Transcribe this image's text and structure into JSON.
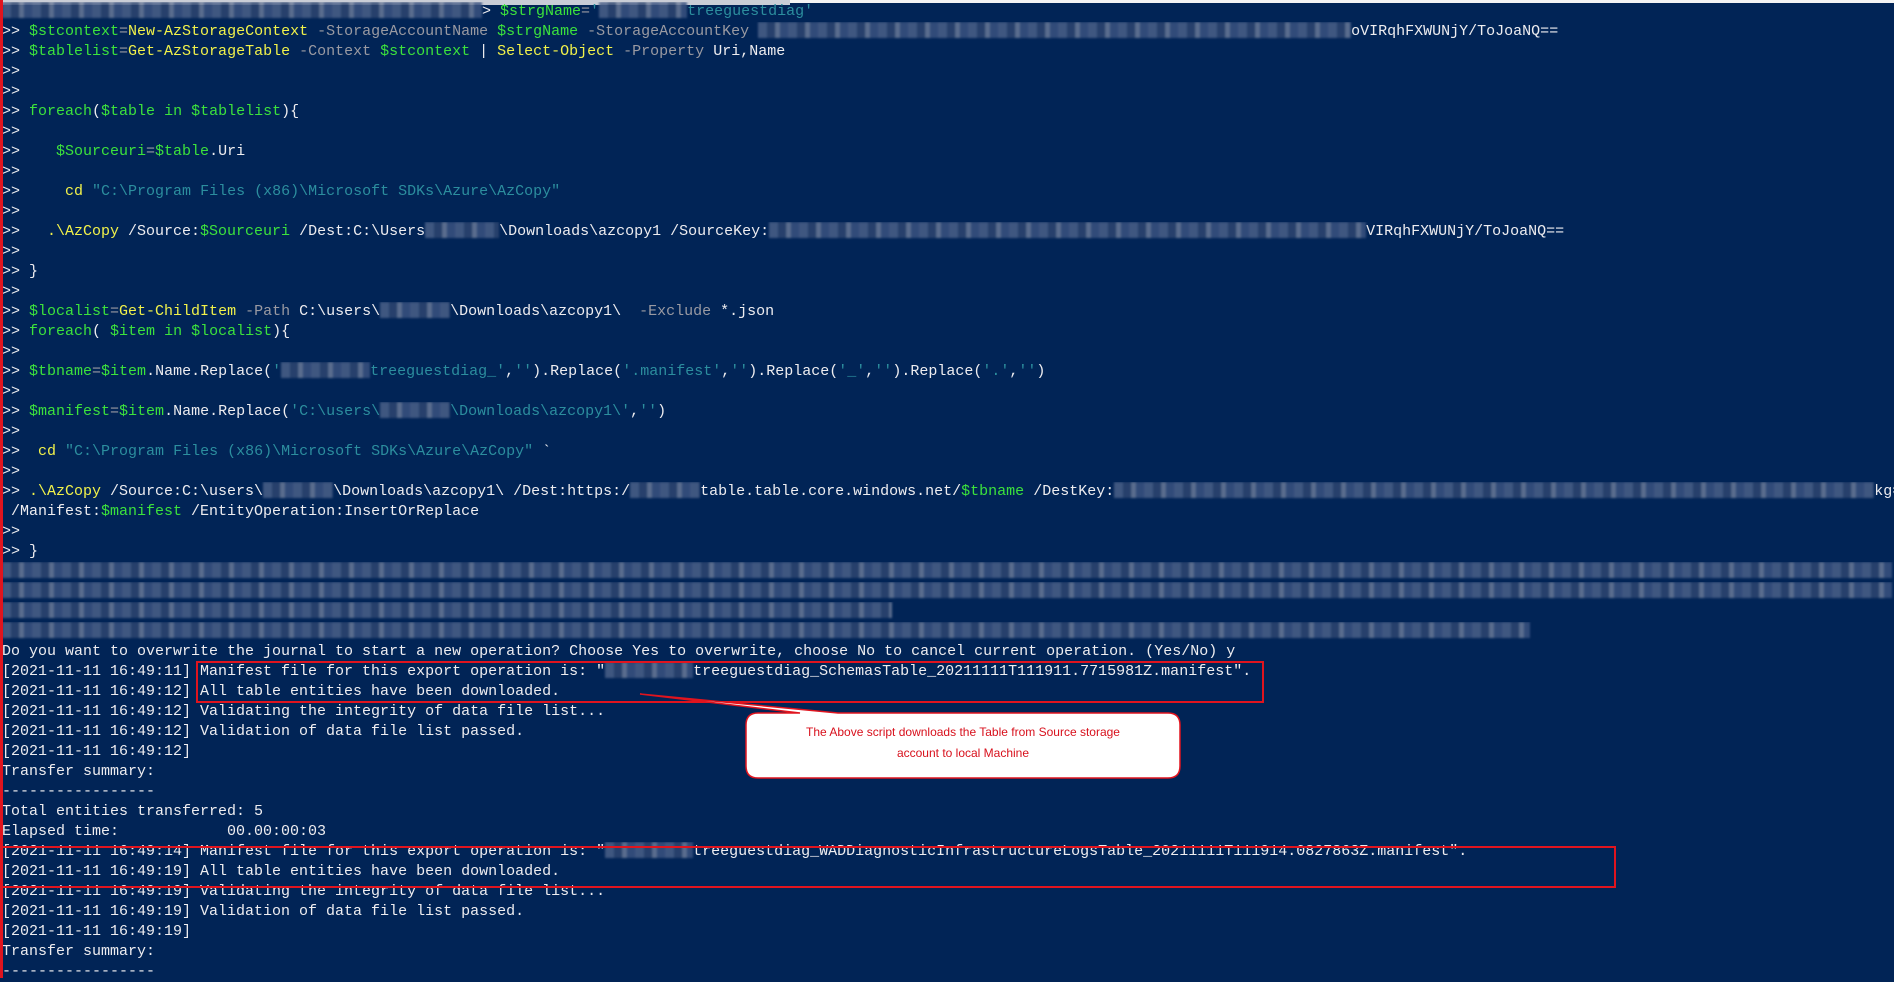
{
  "colors": {
    "background": "#012456",
    "text": "#eeedf0",
    "variable": "#3ce23c",
    "cmdlet": "#f2f24a",
    "parameter": "#9a9aa2",
    "string": "#2c8e9e",
    "highlight": "#e0141e"
  },
  "terminal": {
    "lines": [
      [
        {
          "r": 1
        },
        {
          "t": "> ",
          "c": "d"
        },
        {
          "t": "$strgName",
          "c": "v"
        },
        {
          "t": "=",
          "c": "p"
        },
        {
          "t": "'",
          "c": "s"
        },
        {
          "r": 1
        },
        {
          "t": "treeguestdiag'",
          "c": "s"
        }
      ],
      [
        {
          "t": ">> ",
          "c": "d"
        },
        {
          "t": "$stcontext",
          "c": "v"
        },
        {
          "t": "=",
          "c": "p"
        },
        {
          "t": "New-AzStorageContext",
          "c": "k"
        },
        {
          "t": " -StorageAccountName ",
          "c": "p"
        },
        {
          "t": "$strgName",
          "c": "v"
        },
        {
          "t": " -StorageAccountKey ",
          "c": "p"
        },
        {
          "r": 1
        },
        {
          "t": "oVIRqhFXWUNjY/ToJoaNQ==",
          "c": "d"
        }
      ],
      [
        {
          "t": ">> ",
          "c": "d"
        },
        {
          "t": "$tablelist",
          "c": "v"
        },
        {
          "t": "=",
          "c": "p"
        },
        {
          "t": "Get-AzStorageTable",
          "c": "k"
        },
        {
          "t": " -Context ",
          "c": "p"
        },
        {
          "t": "$stcontext",
          "c": "v"
        },
        {
          "t": " | ",
          "c": "d"
        },
        {
          "t": "Select-Object",
          "c": "k"
        },
        {
          "t": " -Property ",
          "c": "p"
        },
        {
          "t": "Uri,Name",
          "c": "d"
        }
      ],
      [
        {
          "t": ">>",
          "c": "d"
        }
      ],
      [
        {
          "t": ">>",
          "c": "d"
        }
      ],
      [
        {
          "t": ">> ",
          "c": "d"
        },
        {
          "t": "foreach",
          "c": "v"
        },
        {
          "t": "(",
          "c": "d"
        },
        {
          "t": "$table",
          "c": "v"
        },
        {
          "t": " in ",
          "c": "v"
        },
        {
          "t": "$tablelist",
          "c": "v"
        },
        {
          "t": "){",
          "c": "d"
        }
      ],
      [
        {
          "t": ">>",
          "c": "d"
        }
      ],
      [
        {
          "t": ">>    ",
          "c": "d"
        },
        {
          "t": "$Sourceuri",
          "c": "v"
        },
        {
          "t": "=",
          "c": "p"
        },
        {
          "t": "$table",
          "c": "v"
        },
        {
          "t": ".Uri",
          "c": "d"
        }
      ],
      [
        {
          "t": ">>",
          "c": "d"
        }
      ],
      [
        {
          "t": ">>     ",
          "c": "d"
        },
        {
          "t": "cd",
          "c": "k"
        },
        {
          "t": " ",
          "c": "d"
        },
        {
          "t": "\"C:\\Program Files (x86)\\Microsoft SDKs\\Azure\\AzCopy\"",
          "c": "s"
        }
      ],
      [
        {
          "t": ">>",
          "c": "d"
        }
      ],
      [
        {
          "t": ">>   ",
          "c": "d"
        },
        {
          "t": ".\\AzCopy",
          "c": "k"
        },
        {
          "t": " /Source:",
          "c": "d"
        },
        {
          "t": "$Sourceuri",
          "c": "v"
        },
        {
          "t": " /Dest:C:\\Users",
          "c": "d"
        },
        {
          "r": 1
        },
        {
          "t": "\\Downloads\\azcopy1 /SourceKey:",
          "c": "d"
        },
        {
          "r": 1
        },
        {
          "t": "VIRqhFXWUNjY/ToJoaNQ==",
          "c": "d"
        }
      ],
      [
        {
          "t": ">>",
          "c": "d"
        }
      ],
      [
        {
          "t": ">> }",
          "c": "d"
        }
      ],
      [
        {
          "t": ">>",
          "c": "d"
        }
      ],
      [
        {
          "t": ">> ",
          "c": "d"
        },
        {
          "t": "$localist",
          "c": "v"
        },
        {
          "t": "=",
          "c": "p"
        },
        {
          "t": "Get-ChildItem",
          "c": "k"
        },
        {
          "t": " -Path ",
          "c": "p"
        },
        {
          "t": "C:\\users\\",
          "c": "d"
        },
        {
          "r": 1
        },
        {
          "t": "\\Downloads\\azcopy1\\  ",
          "c": "d"
        },
        {
          "t": "-Exclude",
          "c": "p"
        },
        {
          "t": " *.json",
          "c": "d"
        }
      ],
      [
        {
          "t": ">> ",
          "c": "d"
        },
        {
          "t": "foreach",
          "c": "v"
        },
        {
          "t": "( ",
          "c": "d"
        },
        {
          "t": "$item",
          "c": "v"
        },
        {
          "t": " in ",
          "c": "v"
        },
        {
          "t": "$localist",
          "c": "v"
        },
        {
          "t": "){",
          "c": "d"
        }
      ],
      [
        {
          "t": ">>",
          "c": "d"
        }
      ],
      [
        {
          "t": ">> ",
          "c": "d"
        },
        {
          "t": "$tbname",
          "c": "v"
        },
        {
          "t": "=",
          "c": "p"
        },
        {
          "t": "$item",
          "c": "v"
        },
        {
          "t": ".Name.Replace(",
          "c": "d"
        },
        {
          "t": "'",
          "c": "s"
        },
        {
          "r": 1
        },
        {
          "t": "treeguestdiag_'",
          "c": "s"
        },
        {
          "t": ",",
          "c": "d"
        },
        {
          "t": "''",
          "c": "s"
        },
        {
          "t": ").Replace(",
          "c": "d"
        },
        {
          "t": "'.manifest'",
          "c": "s"
        },
        {
          "t": ",",
          "c": "d"
        },
        {
          "t": "''",
          "c": "s"
        },
        {
          "t": ").Replace(",
          "c": "d"
        },
        {
          "t": "'_'",
          "c": "s"
        },
        {
          "t": ",",
          "c": "d"
        },
        {
          "t": "''",
          "c": "s"
        },
        {
          "t": ").Replace(",
          "c": "d"
        },
        {
          "t": "'.'",
          "c": "s"
        },
        {
          "t": ",",
          "c": "d"
        },
        {
          "t": "''",
          "c": "s"
        },
        {
          "t": ")",
          "c": "d"
        }
      ],
      [
        {
          "t": ">>",
          "c": "d"
        }
      ],
      [
        {
          "t": ">> ",
          "c": "d"
        },
        {
          "t": "$manifest",
          "c": "v"
        },
        {
          "t": "=",
          "c": "p"
        },
        {
          "t": "$item",
          "c": "v"
        },
        {
          "t": ".Name.Replace(",
          "c": "d"
        },
        {
          "t": "'C:\\users\\",
          "c": "s"
        },
        {
          "r": 1
        },
        {
          "t": "\\Downloads\\azcopy1\\'",
          "c": "s"
        },
        {
          "t": ",",
          "c": "d"
        },
        {
          "t": "''",
          "c": "s"
        },
        {
          "t": ")",
          "c": "d"
        }
      ],
      [
        {
          "t": ">>",
          "c": "d"
        }
      ],
      [
        {
          "t": ">>  ",
          "c": "d"
        },
        {
          "t": "cd",
          "c": "k"
        },
        {
          "t": " ",
          "c": "d"
        },
        {
          "t": "\"C:\\Program Files (x86)\\Microsoft SDKs\\Azure\\AzCopy\"",
          "c": "s"
        },
        {
          "t": " `",
          "c": "d"
        }
      ],
      [
        {
          "t": ">>",
          "c": "d"
        }
      ],
      [
        {
          "t": ">> ",
          "c": "d"
        },
        {
          "t": ".\\AzCopy",
          "c": "k"
        },
        {
          "t": " /Source:C:\\users\\",
          "c": "d"
        },
        {
          "r": 1
        },
        {
          "t": "\\Downloads\\azcopy1\\ /Dest:https:/",
          "c": "d"
        },
        {
          "r": 1
        },
        {
          "t": "table.table.core.windows.net/",
          "c": "d"
        },
        {
          "t": "$tbname",
          "c": "v"
        },
        {
          "t": " /DestKey:",
          "c": "d"
        },
        {
          "r": 1
        },
        {
          "t": "kg==",
          "c": "d"
        }
      ],
      [
        {
          "t": " /Manifest:",
          "c": "d"
        },
        {
          "t": "$manifest",
          "c": "v"
        },
        {
          "t": " /EntityOperation:InsertOrReplace",
          "c": "d"
        }
      ],
      [
        {
          "t": ">>",
          "c": "d"
        }
      ],
      [
        {
          "t": ">> }",
          "c": "d"
        }
      ],
      [
        {
          "r": 1
        }
      ],
      [
        {
          "r": 1
        }
      ],
      [
        {
          "r": 1
        }
      ],
      [
        {
          "r": 1
        }
      ],
      [
        {
          "t": "Do you want to overwrite the journal to start a new operation? Choose Yes to overwrite, choose No to cancel current operation. (Yes/No) y",
          "c": "d"
        }
      ],
      [
        {
          "t": "[2021-11-11 16:49:11] Manifest file for this export operation is: \"",
          "c": "d"
        },
        {
          "r": 1
        },
        {
          "t": "treeguestdiag_SchemasTable_20211111T111911.7715981Z.manifest\".",
          "c": "d"
        }
      ],
      [
        {
          "t": "[2021-11-11 16:49:12] All table entities have been downloaded.",
          "c": "d"
        }
      ],
      [
        {
          "t": "[2021-11-11 16:49:12] Validating the integrity of data file list...",
          "c": "d"
        }
      ],
      [
        {
          "t": "[2021-11-11 16:49:12] Validation of data file list passed.",
          "c": "d"
        }
      ],
      [
        {
          "t": "[2021-11-11 16:49:12]",
          "c": "d"
        }
      ],
      [
        {
          "t": "Transfer summary:",
          "c": "d"
        }
      ],
      [
        {
          "t": "-----------------",
          "c": "d"
        }
      ],
      [
        {
          "t": "Total entities transferred: 5",
          "c": "d"
        }
      ],
      [
        {
          "t": "Elapsed time:            00.00:00:03",
          "c": "d"
        }
      ],
      [
        {
          "t": "[2021-11-11 16:49:14] Manifest file for this export operation is: \"",
          "c": "d"
        },
        {
          "r": 1
        },
        {
          "t": "treeguestdiag_WADDiagnosticInfrastructureLogsTable_20211111T111914.0827863Z.manifest\".",
          "c": "d"
        }
      ],
      [
        {
          "t": "[2021-11-11 16:49:19] All table entities have been downloaded.",
          "c": "d"
        }
      ],
      [
        {
          "t": "[2021-11-11 16:49:19] Validating the integrity of data file list...",
          "c": "d"
        }
      ],
      [
        {
          "t": "[2021-11-11 16:49:19] Validation of data file list passed.",
          "c": "d"
        }
      ],
      [
        {
          "t": "[2021-11-11 16:49:19]",
          "c": "d"
        }
      ],
      [
        {
          "t": "Transfer summary:",
          "c": "d"
        }
      ],
      [
        {
          "t": "-----------------",
          "c": "d"
        }
      ]
    ]
  },
  "callout": {
    "line1": "The Above script downloads the Table from Source storage",
    "line2": "account to local Machine"
  }
}
